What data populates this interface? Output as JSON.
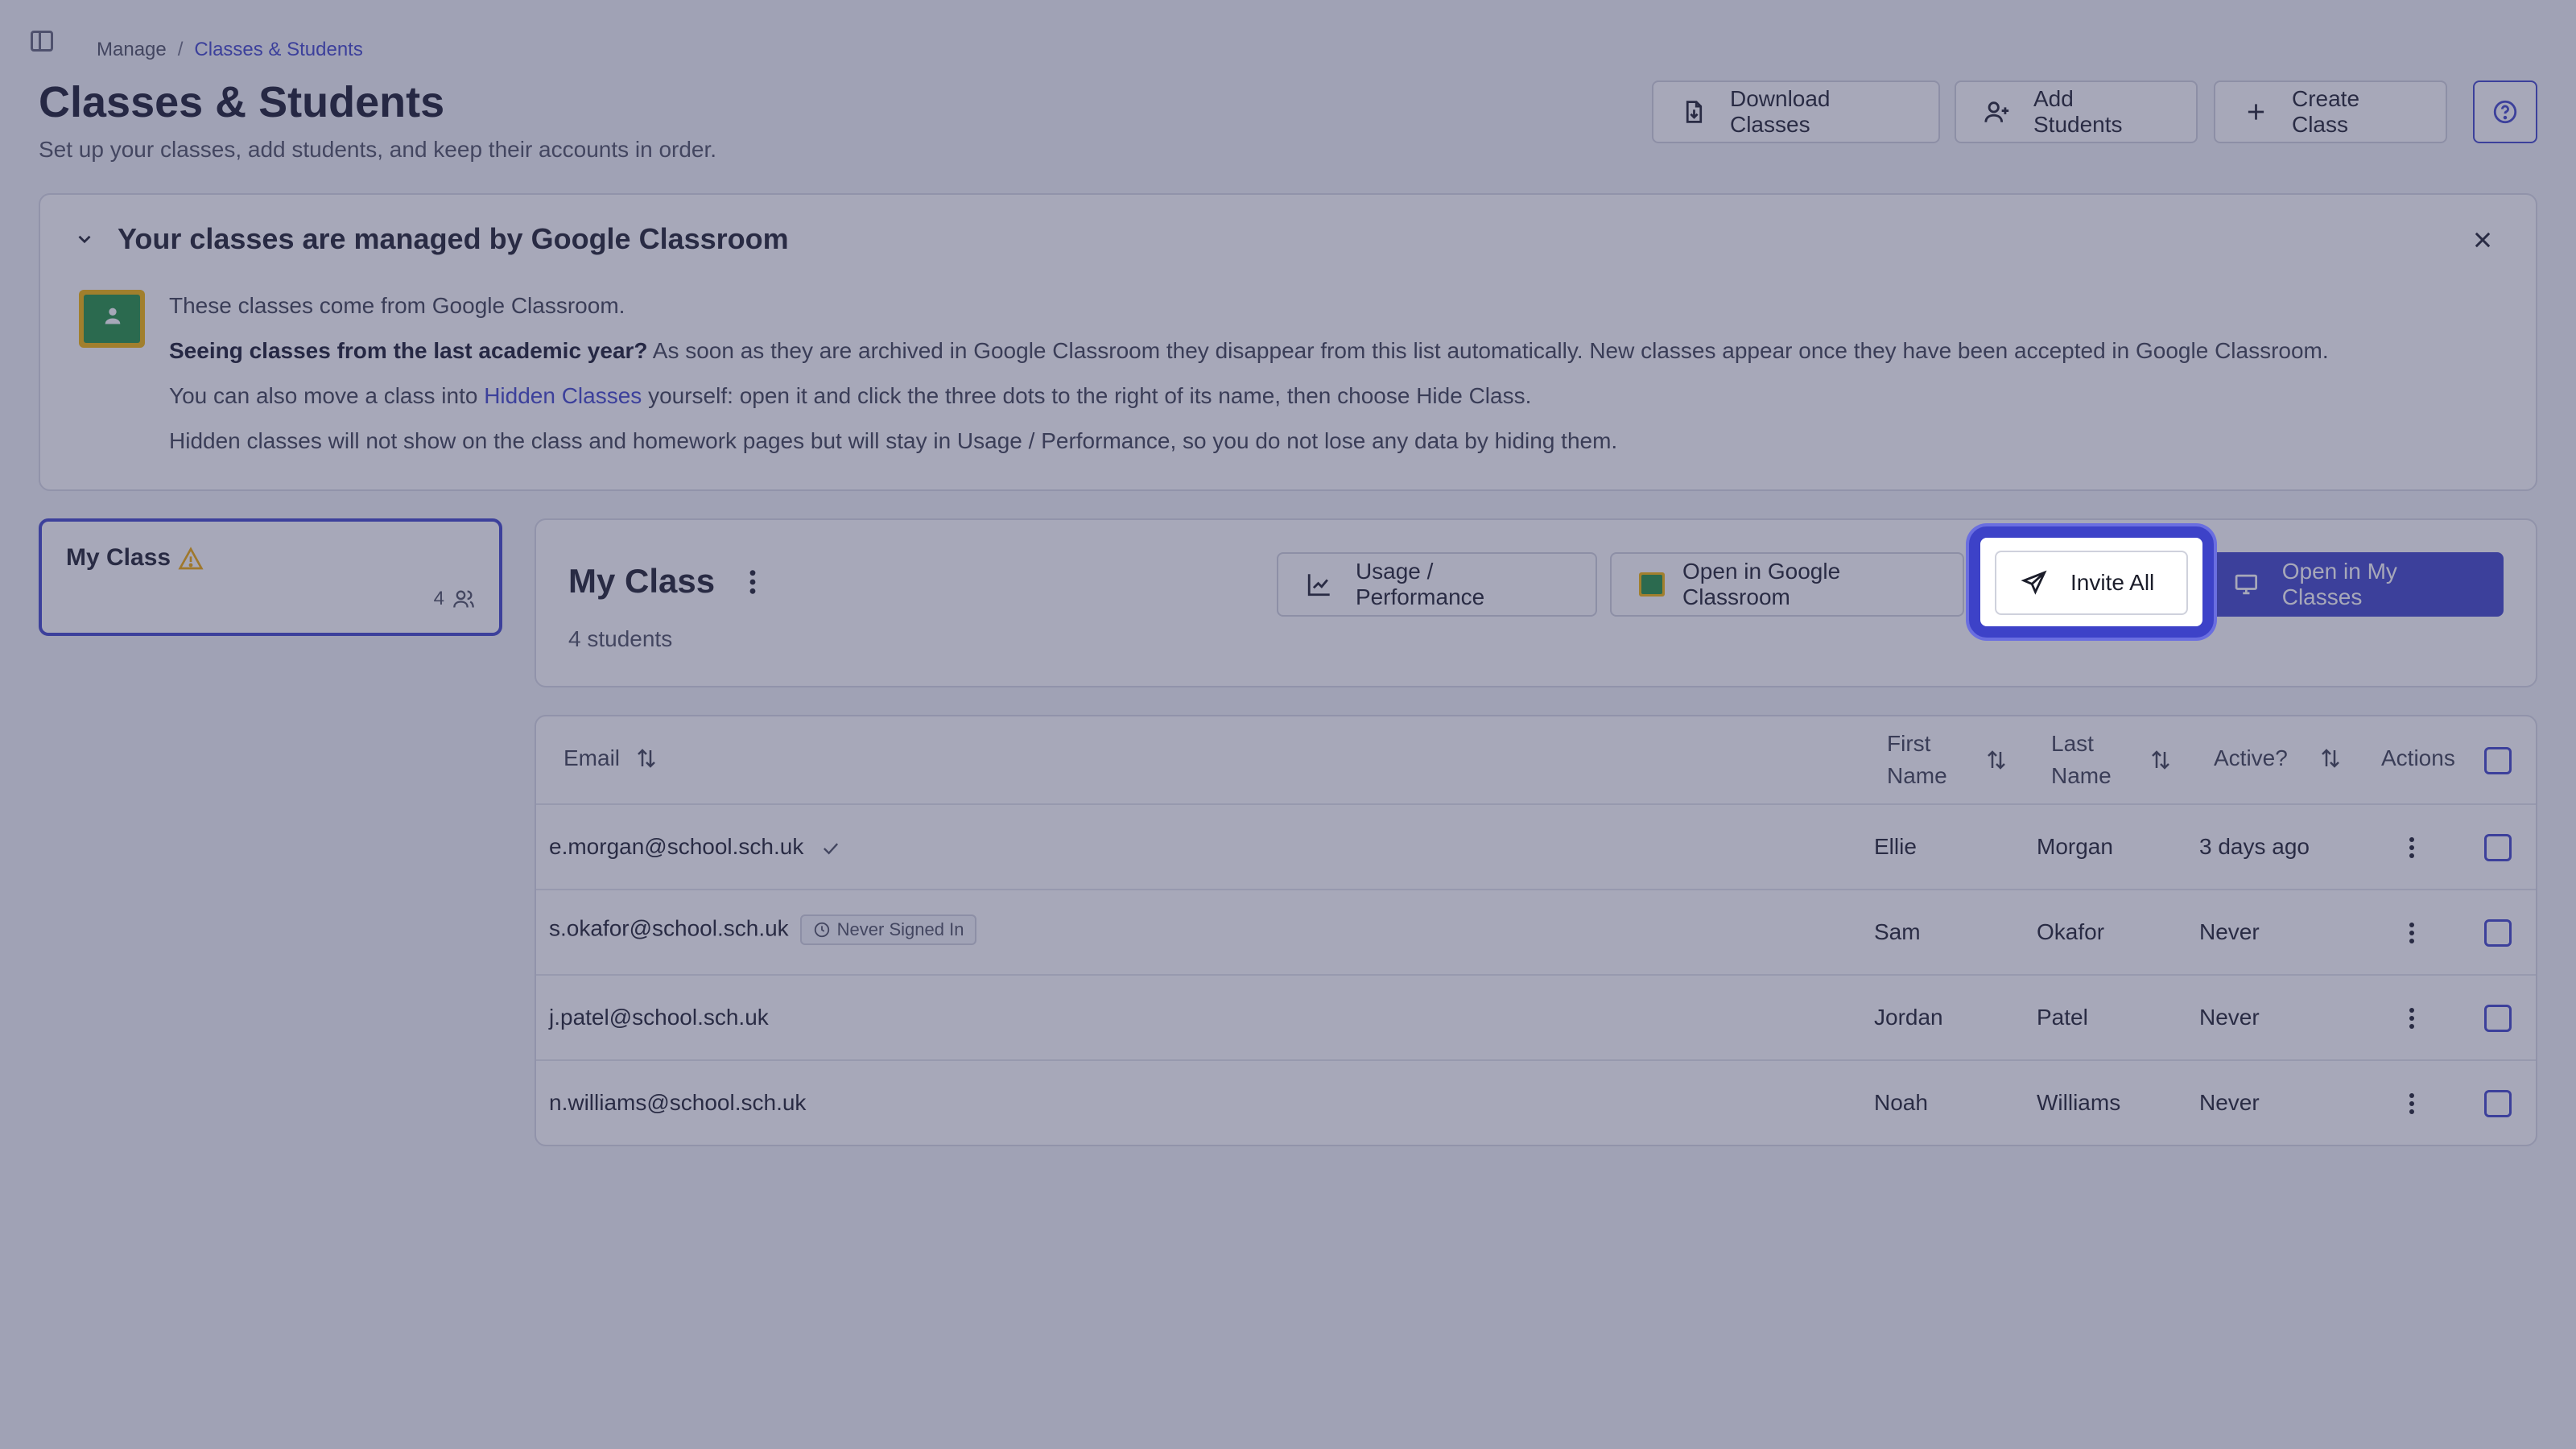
{
  "breadcrumb": {
    "root": "Manage",
    "separator": "/",
    "current": "Classes & Students"
  },
  "header": {
    "title": "Classes & Students",
    "subtitle": "Set up your classes, add students, and keep their accounts in order.",
    "download_label": "Download Classes",
    "add_students_label": "Add Students",
    "create_class_label": "Create Class"
  },
  "banner": {
    "title": "Your classes are managed by Google Classroom",
    "line1": "These classes come from Google Classroom.",
    "line2_bold": "Seeing classes from the last academic year?",
    "line2_rest": " As soon as they are archived in Google Classroom they disappear from this list automatically. New classes appear once they have been accepted in Google Classroom.",
    "line3_pre": "You can also move a class into ",
    "line3_link": "Hidden Classes",
    "line3_post": " yourself: open it and click the three dots to the right of its name, then choose Hide Class.",
    "line4": "Hidden classes will not show on the class and homework pages but will stay in Usage / Performance, so you do not lose any data by hiding them."
  },
  "class_list": [
    {
      "name": "My Class",
      "count": "4"
    }
  ],
  "class_detail": {
    "title": "My Class",
    "subtitle": "4 students",
    "usage_label": "Usage / Performance",
    "open_gc_label": "Open in Google Classroom",
    "invite_label": "Invite All",
    "open_my_classes_label": "Open in My Classes"
  },
  "table": {
    "headers": {
      "email": "Email",
      "first_name_1": "First",
      "first_name_2": "Name",
      "last_name_1": "Last",
      "last_name_2": "Name",
      "active": "Active?",
      "actions": "Actions"
    },
    "rows": [
      {
        "email": "e.morgan@school.sch.uk",
        "badge": "",
        "first": "Ellie",
        "last": "Morgan",
        "active": "3 days ago"
      },
      {
        "email": "s.okafor@school.sch.uk",
        "badge": "Never Signed In",
        "first": "Sam",
        "last": "Okafor",
        "active": "Never"
      },
      {
        "email": "j.patel@school.sch.uk",
        "badge": "",
        "first": "Jordan",
        "last": "Patel",
        "active": "Never"
      },
      {
        "email": "n.williams@school.sch.uk",
        "badge": "",
        "first": "Noah",
        "last": "Williams",
        "active": "Never"
      }
    ]
  },
  "colors": {
    "accent": "#3d42c8",
    "warning": "#f0a800"
  },
  "icons": [
    "sidebar-toggle-icon",
    "download-file-icon",
    "user-plus-icon",
    "plus-icon",
    "help-icon",
    "chevron-down-icon",
    "close-icon",
    "google-classroom-icon",
    "warning-icon",
    "users-icon",
    "kebab-icon",
    "chart-icon",
    "send-icon",
    "monitor-icon",
    "sort-icon",
    "check-icon",
    "clock-icon"
  ]
}
